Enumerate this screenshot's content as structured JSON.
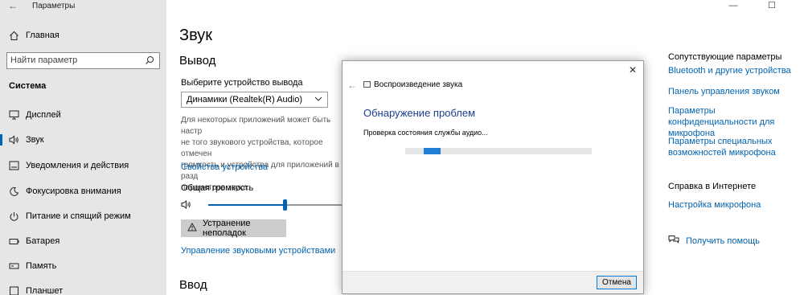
{
  "window": {
    "title": "Параметры",
    "controls": {
      "minimize": "—",
      "maximize": "☐",
      "close": "✕"
    }
  },
  "sidebar": {
    "home": "Главная",
    "search_placeholder": "Найти параметр",
    "section": "Система",
    "items": [
      {
        "label": "Дисплей",
        "icon": "monitor-icon"
      },
      {
        "label": "Звук",
        "icon": "speaker-icon",
        "active": true
      },
      {
        "label": "Уведомления и действия",
        "icon": "notification-icon"
      },
      {
        "label": "Фокусировка внимания",
        "icon": "moon-icon"
      },
      {
        "label": "Питание и спящий режим",
        "icon": "power-icon"
      },
      {
        "label": "Батарея",
        "icon": "battery-icon"
      },
      {
        "label": "Память",
        "icon": "storage-icon"
      },
      {
        "label": "Планшет",
        "icon": "tablet-icon"
      }
    ]
  },
  "main": {
    "title": "Звук",
    "output_heading": "Вывод",
    "choose_device_label": "Выберите устройство вывода",
    "device_selected": "Динамики (Realtek(R) Audio)",
    "description": "Для некоторых приложений может быть настр\nне того звукового устройства, которое отмечен\nгромкость и устройства для приложений в разд\nпараметров звука.",
    "device_properties_link": "Свойства устройства",
    "volume_label": "Общая громкость",
    "volume_level": 0.54,
    "troubleshoot_button": "Устранение неполадок",
    "manage_devices_link": "Управление звуковыми устройствами",
    "input_heading": "Ввод"
  },
  "related": {
    "heading": "Сопутствующие параметры",
    "links": [
      "Bluetooth и другие устройства",
      "Панель управления звуком",
      "Параметры конфиденциальности для микрофона",
      "Параметры специальных возможностей микрофона"
    ],
    "help_heading": "Справка в Интернете",
    "help_links": [
      "Настройка микрофона"
    ],
    "get_help": "Получить помощь"
  },
  "dialog": {
    "app_title": "Воспроизведение звука",
    "heading": "Обнаружение проблем",
    "status": "Проверка состояния службы аудио...",
    "progress_start": 0.1,
    "progress_end": 0.19,
    "cancel_button": "Отмена",
    "close_symbol": "✕",
    "back_symbol": "←"
  },
  "colors": {
    "accent": "#0063b1",
    "sidebar_bg": "#e6e6e6",
    "dialog_heading": "#1a3d8f",
    "progress": "#1e7fd3"
  }
}
